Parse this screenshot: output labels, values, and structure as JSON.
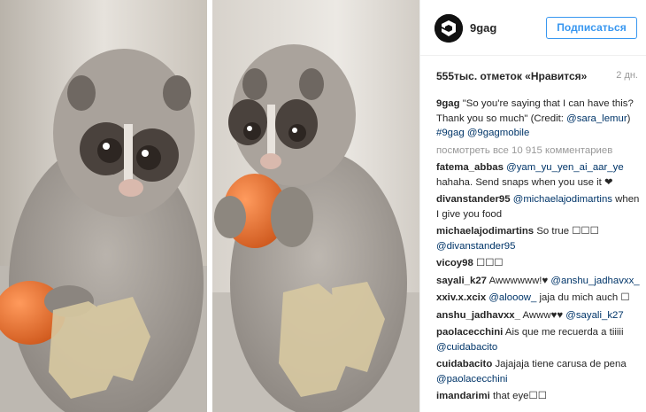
{
  "post": {
    "username": "9gag",
    "follow_label": "Подписаться",
    "likes": "555тыс. отметок «Нравится»",
    "time": "2 дн.",
    "caption": {
      "user": "9gag",
      "text": "\"So you're saying that I can have this? Thank you so much\" (Credit: ",
      "credit": "@sara_lemur",
      "close": ")",
      "tags": "#9gag @9gagmobile"
    },
    "view_all": "посмотреть все 10 915 комментариев",
    "comments": [
      {
        "user": "fatema_abbas",
        "mention": "@yam_yu_yen_ai_aar_ye",
        "text": "hahaha. Send snaps when you use it ❤"
      },
      {
        "user": "divanstander95",
        "mention": "@michaelajodimartins",
        "text": "when I give you food"
      },
      {
        "user": "michaelajodimartins",
        "mention": "",
        "text": "So true ☐☐☐",
        "mention_after": "@divanstander95"
      },
      {
        "user": "vicoy98",
        "mention": "",
        "text": "☐☐☐"
      },
      {
        "user": "sayali_k27",
        "mention": "",
        "text": "Awwwwww!♥",
        "mention_after": "@anshu_jadhavxx_"
      },
      {
        "user": "xxiv.x.xcix",
        "mention": "@alooow_",
        "text": "jaja du mich auch ☐"
      },
      {
        "user": "anshu_jadhavxx_",
        "mention": "",
        "text": "Awww♥♥",
        "mention_after": "@sayali_k27"
      },
      {
        "user": "paolacecchini",
        "mention": "",
        "text": "Ais que me recuerda a tiiiii",
        "mention_after": "@cuidabacito"
      },
      {
        "user": "cuidabacito",
        "mention": "",
        "text": "Jajajaja tiene carusa de pena",
        "mention_after": "@paolacecchini"
      },
      {
        "user": "imandarimi",
        "mention": "",
        "text": "that eye☐☐"
      }
    ]
  },
  "colors": {
    "link": "#003569",
    "follow": "#3897f0",
    "muted": "#999999"
  },
  "icons": {
    "avatar": "9gag-logo-icon"
  }
}
